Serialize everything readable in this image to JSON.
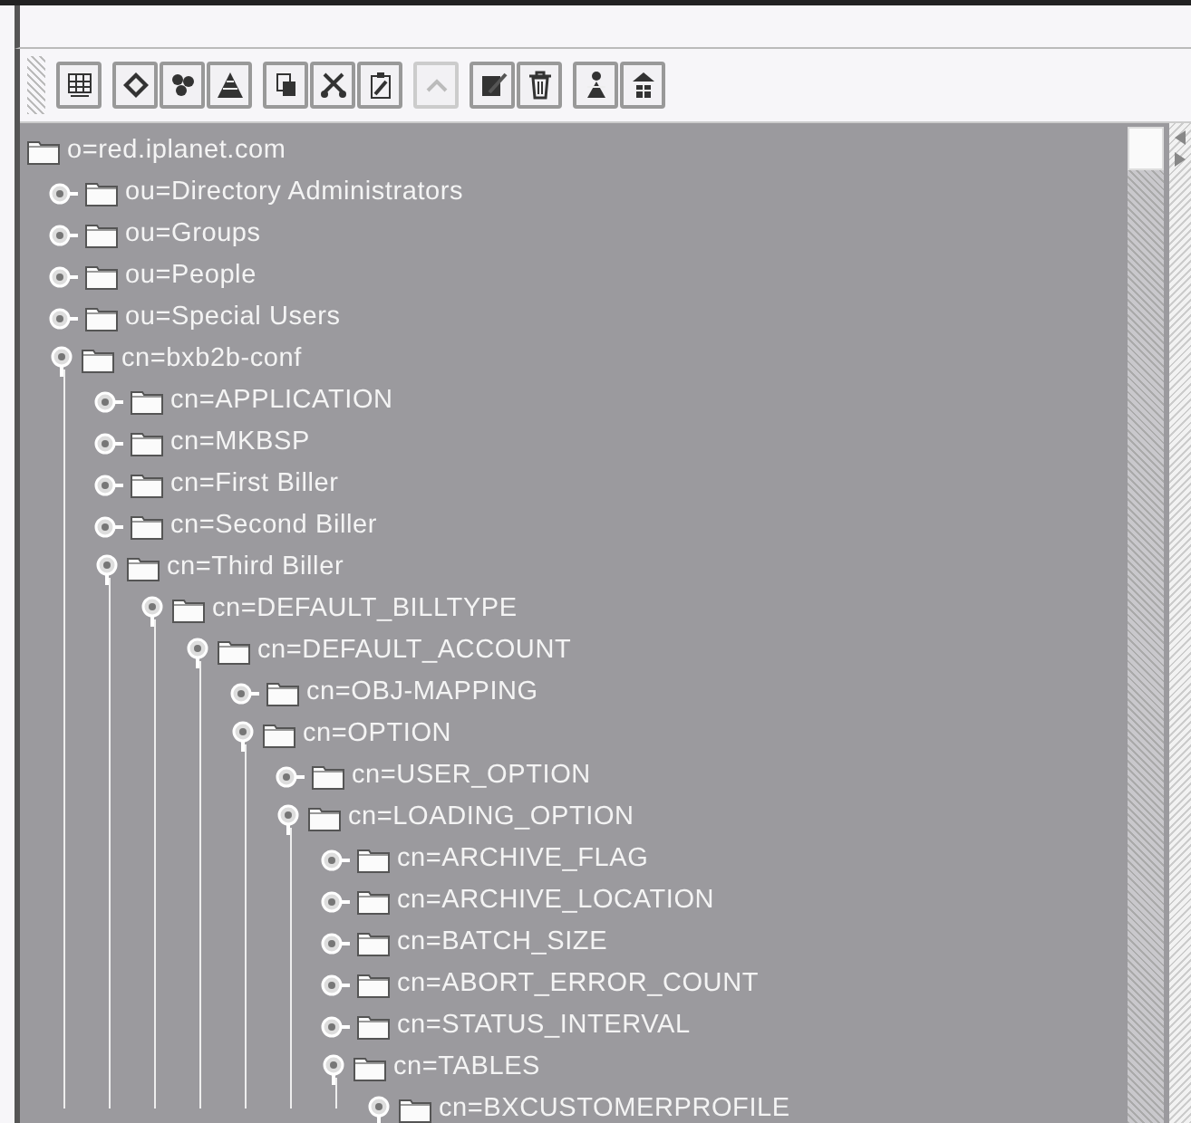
{
  "toolbar": {
    "groups": [
      [
        {
          "kind": "grid",
          "disabled": false
        }
      ],
      [
        {
          "kind": "diamond",
          "disabled": false
        },
        {
          "kind": "cluster",
          "disabled": false
        },
        {
          "kind": "pyramid",
          "disabled": false
        }
      ],
      [
        {
          "kind": "copy",
          "disabled": false
        },
        {
          "kind": "cut",
          "disabled": false
        },
        {
          "kind": "paste",
          "disabled": false
        }
      ],
      [
        {
          "kind": "up",
          "disabled": true
        }
      ],
      [
        {
          "kind": "edit",
          "disabled": false
        },
        {
          "kind": "trash",
          "disabled": false
        }
      ],
      [
        {
          "kind": "person-down",
          "disabled": false
        },
        {
          "kind": "person-up",
          "disabled": false
        }
      ]
    ]
  },
  "tree": {
    "label": "o=red.iplanet.com",
    "children": [
      {
        "label": "ou=Directory Administrators",
        "expanded": false
      },
      {
        "label": "ou=Groups",
        "expanded": false
      },
      {
        "label": "ou=People",
        "expanded": false
      },
      {
        "label": "ou=Special Users",
        "expanded": false
      },
      {
        "label": "cn=bxb2b-conf",
        "expanded": true,
        "children": [
          {
            "label": "cn=APPLICATION",
            "expanded": false
          },
          {
            "label": "cn=MKBSP",
            "expanded": false
          },
          {
            "label": "cn=First Biller",
            "expanded": false
          },
          {
            "label": "cn=Second Biller",
            "expanded": false
          },
          {
            "label": "cn=Third Biller",
            "expanded": true,
            "children": [
              {
                "label": "cn=DEFAULT_BILLTYPE",
                "expanded": true,
                "children": [
                  {
                    "label": "cn=DEFAULT_ACCOUNT",
                    "expanded": true,
                    "children": [
                      {
                        "label": "cn=OBJ-MAPPING",
                        "expanded": false
                      },
                      {
                        "label": "cn=OPTION",
                        "expanded": true,
                        "children": [
                          {
                            "label": "cn=USER_OPTION",
                            "expanded": false
                          },
                          {
                            "label": "cn=LOADING_OPTION",
                            "expanded": true,
                            "children": [
                              {
                                "label": "cn=ARCHIVE_FLAG",
                                "expanded": false
                              },
                              {
                                "label": "cn=ARCHIVE_LOCATION",
                                "expanded": false
                              },
                              {
                                "label": "cn=BATCH_SIZE",
                                "expanded": false
                              },
                              {
                                "label": "cn=ABORT_ERROR_COUNT",
                                "expanded": false
                              },
                              {
                                "label": "cn=STATUS_INTERVAL",
                                "expanded": false
                              },
                              {
                                "label": "cn=TABLES",
                                "expanded": true,
                                "children": [
                                  {
                                    "label": "cn=BXCUSTOMERPROFILE",
                                    "expanded": true
                                  }
                                ]
                              }
                            ]
                          }
                        ]
                      }
                    ]
                  }
                ]
              }
            ]
          }
        ]
      }
    ]
  }
}
